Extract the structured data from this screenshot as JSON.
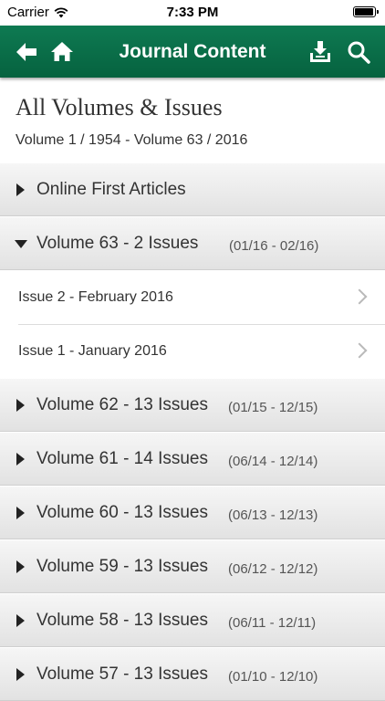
{
  "status": {
    "carrier": "Carrier",
    "time": "7:33 PM",
    "battery_level": 0.95
  },
  "nav": {
    "title": "Journal Content",
    "back_icon": "arrow-left-icon",
    "home_icon": "home-icon",
    "download_icon": "download-icon",
    "search_icon": "search-icon"
  },
  "header": {
    "title": "All Volumes & Issues",
    "subtitle": "Volume 1 / 1954 - Volume 63 / 2016"
  },
  "online_first": {
    "label": "Online First Articles"
  },
  "volumes": [
    {
      "label": "Volume 63 - 2 Issues",
      "range": "(01/16 - 02/16)",
      "expanded": true
    },
    {
      "label": "Volume 62 - 13 Issues",
      "range": "(01/15 - 12/15)",
      "expanded": false
    },
    {
      "label": "Volume 61 - 14 Issues",
      "range": "(06/14 - 12/14)",
      "expanded": false
    },
    {
      "label": "Volume 60 - 13 Issues",
      "range": "(06/13 - 12/13)",
      "expanded": false
    },
    {
      "label": "Volume 59 - 13 Issues",
      "range": "(06/12 - 12/12)",
      "expanded": false
    },
    {
      "label": "Volume 58 - 13 Issues",
      "range": "(06/11 - 12/11)",
      "expanded": false
    },
    {
      "label": "Volume 57 - 13 Issues",
      "range": "(01/10 - 12/10)",
      "expanded": false
    }
  ],
  "issues": [
    {
      "label": "Issue 2 - February 2016"
    },
    {
      "label": "Issue 1 - January 2016"
    }
  ],
  "colors": {
    "nav_bar": "#0e7a52",
    "row_gradient_top": "#f6f6f6",
    "row_gradient_bottom": "#e2e2e2"
  }
}
